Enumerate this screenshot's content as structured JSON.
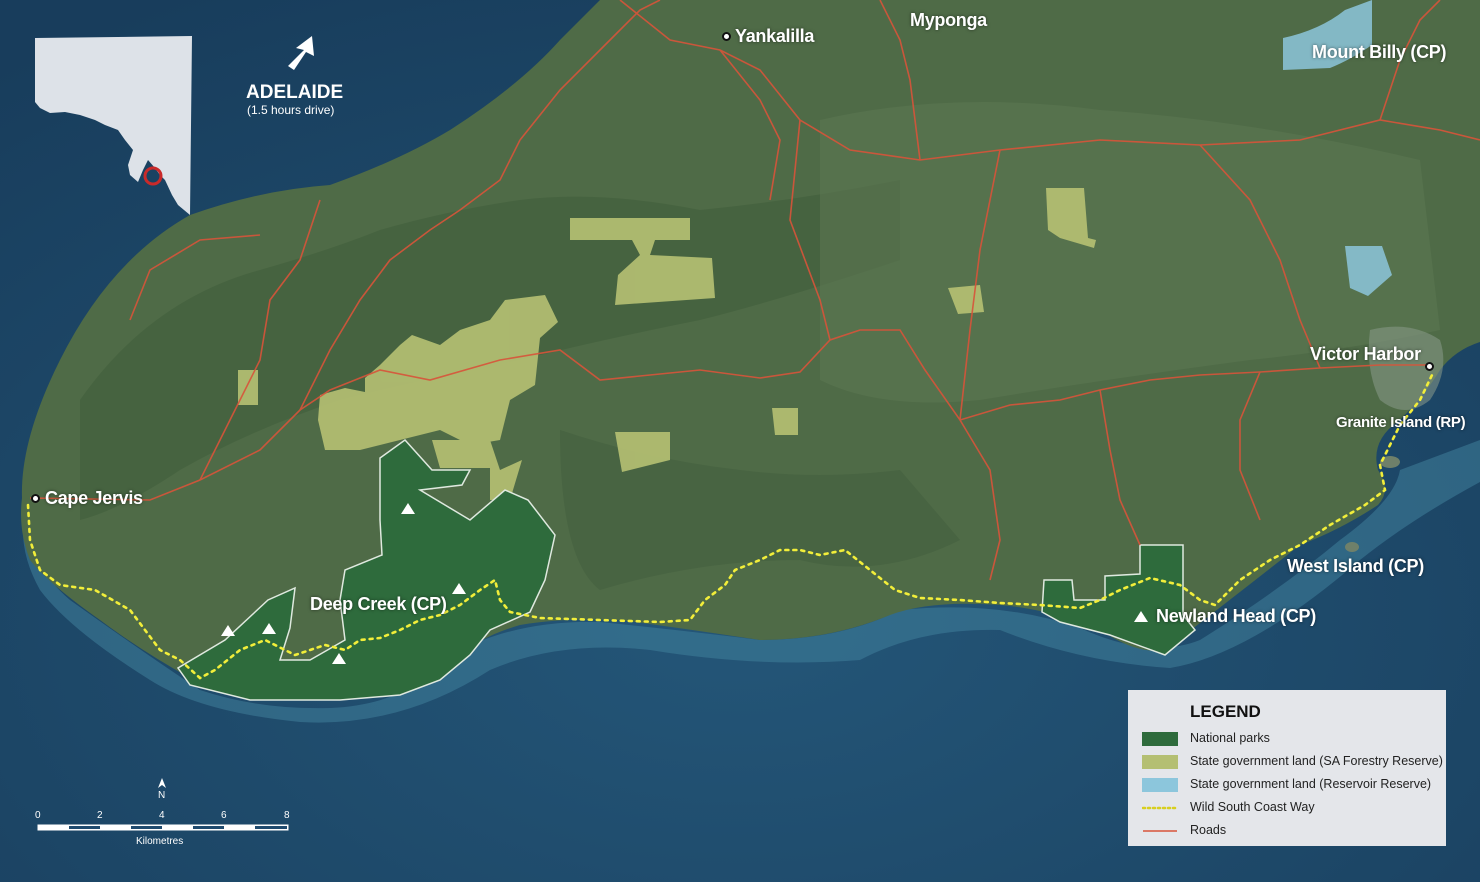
{
  "towns": {
    "yankalilla": "Yankalilla",
    "cape_jervis": "Cape Jervis",
    "victor_harbor": "Victor Harbor"
  },
  "places": {
    "myponga": "Myponga",
    "mount_billy": "Mount Billy (CP)",
    "granite_island": "Granite Island (RP)",
    "west_island": "West Island (CP)",
    "deep_creek": "Deep Creek (CP)",
    "newland_head": "Newland Head (CP)"
  },
  "adelaide": {
    "title": "ADELAIDE",
    "subtitle": "(1.5 hours drive)"
  },
  "legend": {
    "title": "LEGEND",
    "items": [
      {
        "label": "National parks",
        "color": "#2e6b3c"
      },
      {
        "label": "State government land (SA Forestry Reserve)",
        "color": "#b4bf72"
      },
      {
        "label": "State government land (Reservoir Reserve)",
        "color": "#8cc6dc"
      },
      {
        "label": "Wild South Coast Way",
        "color": "#f2ee3a"
      },
      {
        "label": "Roads",
        "color": "#d8543a"
      }
    ]
  },
  "scale": {
    "ticks": [
      "0",
      "2",
      "4",
      "6",
      "8"
    ],
    "unit": "Kilometres",
    "north": "N"
  },
  "colors": {
    "sea": "#1f4a6e",
    "land": "#4f6b47",
    "national_park": "#2e6b3c",
    "forestry": "#b4bf72",
    "reservoir": "#8cc6dc",
    "trail": "#f2ee3a",
    "road": "#d8543a"
  }
}
